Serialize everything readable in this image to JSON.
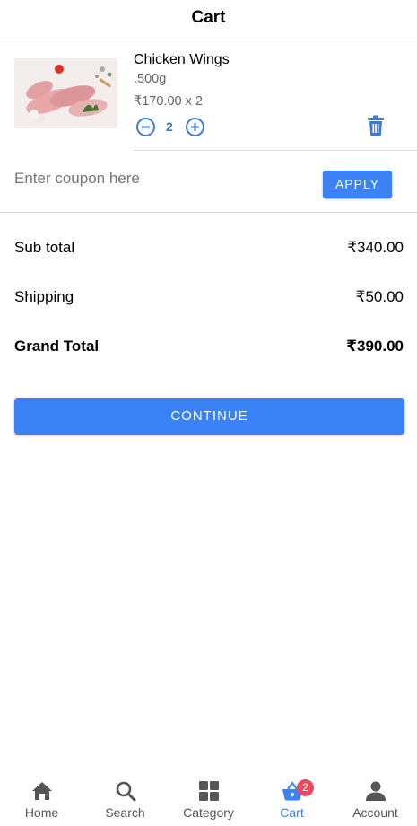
{
  "header": {
    "title": "Cart"
  },
  "cart": {
    "items": [
      {
        "name": "Chicken Wings",
        "weight": ".500g",
        "price_line": "₹170.00 x 2",
        "quantity": "2",
        "image_icon": "chicken-wings-image"
      }
    ]
  },
  "coupon": {
    "placeholder": "Enter coupon here",
    "apply_label": "APPLY"
  },
  "summary": {
    "subtotal_label": "Sub total",
    "subtotal_value": "₹340.00",
    "shipping_label": "Shipping",
    "shipping_value": "₹50.00",
    "grand_label": "Grand Total",
    "grand_value": "₹390.00"
  },
  "continue_label": "CONTINUE",
  "nav": {
    "items": [
      {
        "label": "Home",
        "icon": "home-icon"
      },
      {
        "label": "Search",
        "icon": "search-icon"
      },
      {
        "label": "Category",
        "icon": "grid-icon"
      },
      {
        "label": "Cart",
        "icon": "basket-icon",
        "badge": "2",
        "active": true
      },
      {
        "label": "Account",
        "icon": "person-icon"
      }
    ]
  },
  "colors": {
    "accent": "#3b82f6",
    "badge": "#e74a5d",
    "text_muted": "#666666"
  }
}
